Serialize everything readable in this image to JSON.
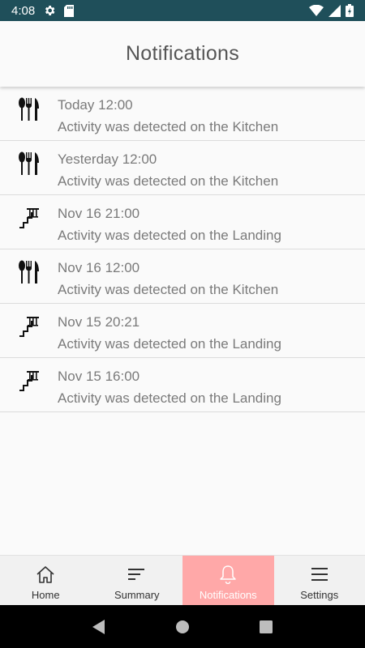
{
  "status_bar": {
    "time": "4:08",
    "icons": [
      "gear-icon",
      "sd-card-icon",
      "wifi-icon",
      "signal-icon",
      "battery-charging-icon"
    ]
  },
  "header": {
    "title": "Notifications"
  },
  "notifications": [
    {
      "icon": "cutlery-icon",
      "time": "Today 12:00",
      "message": "Activity was detected on the Kitchen"
    },
    {
      "icon": "cutlery-icon",
      "time": "Yesterday 12:00",
      "message": "Activity was detected on the Kitchen"
    },
    {
      "icon": "stairs-icon",
      "time": "Nov 16 21:00",
      "message": "Activity was detected on the Landing"
    },
    {
      "icon": "cutlery-icon",
      "time": "Nov 16 12:00",
      "message": "Activity was detected on the Kitchen"
    },
    {
      "icon": "stairs-icon",
      "time": "Nov 15 20:21",
      "message": "Activity was detected on the Landing"
    },
    {
      "icon": "stairs-icon",
      "time": "Nov 15 16:00",
      "message": "Activity was detected on the Landing"
    }
  ],
  "bottom_nav": {
    "items": [
      {
        "label": "Home",
        "icon": "home-icon"
      },
      {
        "label": "Summary",
        "icon": "summary-icon"
      },
      {
        "label": "Notifications",
        "icon": "bell-icon",
        "active": true
      },
      {
        "label": "Settings",
        "icon": "menu-icon"
      }
    ],
    "active_color": "#ffa8a8"
  },
  "colors": {
    "status_bar": "#1f4f5a",
    "text": "#7a7a7a"
  }
}
